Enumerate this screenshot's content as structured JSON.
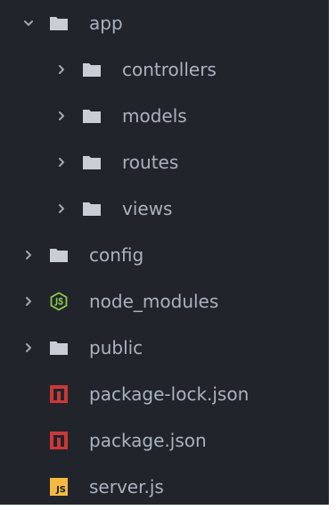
{
  "tree": {
    "items": [
      {
        "label": "app",
        "icon": "folder-icon",
        "expanded": true
      },
      {
        "label": "controllers",
        "icon": "folder-icon",
        "expanded": false
      },
      {
        "label": "models",
        "icon": "folder-icon",
        "expanded": false
      },
      {
        "label": "routes",
        "icon": "folder-icon",
        "expanded": false
      },
      {
        "label": "views",
        "icon": "folder-icon",
        "expanded": false
      },
      {
        "label": "config",
        "icon": "folder-icon",
        "expanded": false
      },
      {
        "label": "node_modules",
        "icon": "nodejs-icon",
        "expanded": false
      },
      {
        "label": "public",
        "icon": "folder-icon",
        "expanded": false
      },
      {
        "label": "package-lock.json",
        "icon": "npm-icon"
      },
      {
        "label": "package.json",
        "icon": "npm-icon"
      },
      {
        "label": "server.js",
        "icon": "javascript-icon",
        "badge": "JS"
      }
    ]
  },
  "colors": {
    "background": "#21252b",
    "text": "#abb2bf",
    "folder": "#c8cdd6",
    "chevron": "#a0a7b3",
    "npm": "#cb3837",
    "node": "#8cc84b",
    "javascript": "#f5b942"
  }
}
